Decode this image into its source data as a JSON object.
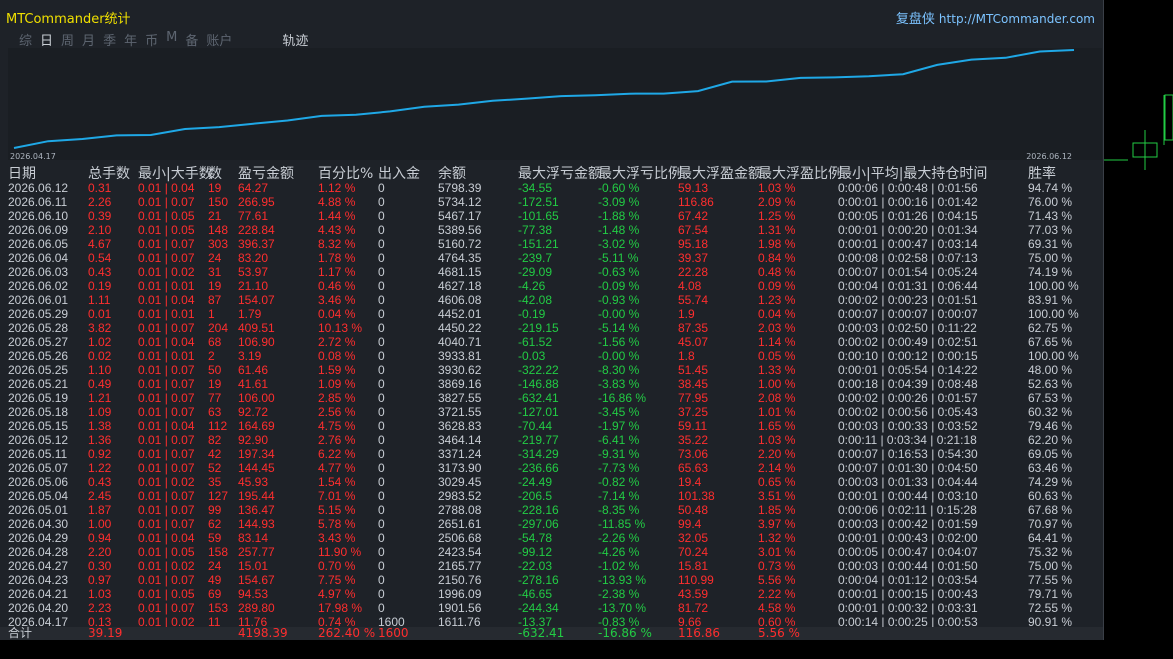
{
  "window": {
    "title": "MTCommander统计",
    "brand": "复盘侠",
    "url": "http://MTCommander.com"
  },
  "tabs": [
    {
      "label": "综",
      "active": false
    },
    {
      "label": "日",
      "active": true
    },
    {
      "label": "周",
      "active": false
    },
    {
      "label": "月",
      "active": false
    },
    {
      "label": "季",
      "active": false
    },
    {
      "label": "年",
      "active": false
    },
    {
      "label": "币",
      "active": false
    },
    {
      "label": "M",
      "active": false
    },
    {
      "label": "备",
      "active": false
    },
    {
      "label": "账户",
      "active": false
    },
    {
      "label": "轨迹",
      "active": false
    }
  ],
  "chart_data": {
    "type": "line",
    "x_start_label": "2026.04.17",
    "x_end_label": "2026.06.12",
    "x": [
      "2026.04.17",
      "2026.04.20",
      "2026.04.21",
      "2026.04.23",
      "2026.04.27",
      "2026.04.28",
      "2026.04.29",
      "2026.04.30",
      "2026.05.01",
      "2026.05.04",
      "2026.05.06",
      "2026.05.07",
      "2026.05.11",
      "2026.05.12",
      "2026.05.15",
      "2026.05.18",
      "2026.05.19",
      "2026.05.21",
      "2026.05.25",
      "2026.05.26",
      "2026.05.27",
      "2026.05.28",
      "2026.05.29",
      "2026.06.01",
      "2026.06.02",
      "2026.06.03",
      "2026.06.04",
      "2026.06.05",
      "2026.06.09",
      "2026.06.10",
      "2026.06.11",
      "2026.06.12"
    ],
    "values": [
      1611.76,
      1901.56,
      1996.09,
      2150.76,
      2165.77,
      2423.54,
      2506.68,
      2651.61,
      2788.08,
      2983.52,
      3029.45,
      3173.9,
      3371.24,
      3464.14,
      3628.83,
      3721.55,
      3827.55,
      3869.16,
      3930.62,
      3933.81,
      4040.71,
      4450.22,
      4452.01,
      4606.08,
      4627.18,
      4681.15,
      4764.35,
      5160.72,
      5389.56,
      5467.17,
      5734.12,
      5798.39
    ],
    "series_color": "#1fa8e6"
  },
  "table": {
    "headers": [
      "日期",
      "总手数",
      "最小|大手数",
      "数",
      "盈亏金额",
      "百分比%",
      "出入金",
      "余额",
      "最大浮亏金额",
      "最大浮亏比例",
      "最大浮盈金额",
      "最大浮盈比例",
      "最小|平均|最大持仓时间",
      "胜率"
    ],
    "rows": [
      [
        "2026.06.12",
        "0.31",
        "0.01 | 0.04",
        "19",
        "64.27",
        "1.12 %",
        "0",
        "5798.39",
        "-34.55",
        "-0.60 %",
        "59.13",
        "1.03 %",
        "0:00:06 | 0:00:48 | 0:01:56",
        "94.74 %"
      ],
      [
        "2026.06.11",
        "2.26",
        "0.01 | 0.07",
        "150",
        "266.95",
        "4.88 %",
        "0",
        "5734.12",
        "-172.51",
        "-3.09 %",
        "116.86",
        "2.09 %",
        "0:00:01 | 0:00:16 | 0:01:42",
        "76.00 %"
      ],
      [
        "2026.06.10",
        "0.39",
        "0.01 | 0.05",
        "21",
        "77.61",
        "1.44 %",
        "0",
        "5467.17",
        "-101.65",
        "-1.88 %",
        "67.42",
        "1.25 %",
        "0:00:05 | 0:01:26 | 0:04:15",
        "71.43 %"
      ],
      [
        "2026.06.09",
        "2.10",
        "0.01 | 0.05",
        "148",
        "228.84",
        "4.43 %",
        "0",
        "5389.56",
        "-77.38",
        "-1.48 %",
        "67.54",
        "1.31 %",
        "0:00:01 | 0:00:20 | 0:01:34",
        "77.03 %"
      ],
      [
        "2026.06.05",
        "4.67",
        "0.01 | 0.07",
        "303",
        "396.37",
        "8.32 %",
        "0",
        "5160.72",
        "-151.21",
        "-3.02 %",
        "95.18",
        "1.98 %",
        "0:00:01 | 0:00:47 | 0:03:14",
        "69.31 %"
      ],
      [
        "2026.06.04",
        "0.54",
        "0.01 | 0.07",
        "24",
        "83.20",
        "1.78 %",
        "0",
        "4764.35",
        "-239.7",
        "-5.11 %",
        "39.37",
        "0.84 %",
        "0:00:08 | 0:02:58 | 0:07:13",
        "75.00 %"
      ],
      [
        "2026.06.03",
        "0.43",
        "0.01 | 0.02",
        "31",
        "53.97",
        "1.17 %",
        "0",
        "4681.15",
        "-29.09",
        "-0.63 %",
        "22.28",
        "0.48 %",
        "0:00:07 | 0:01:54 | 0:05:24",
        "74.19 %"
      ],
      [
        "2026.06.02",
        "0.19",
        "0.01 | 0.01",
        "19",
        "21.10",
        "0.46 %",
        "0",
        "4627.18",
        "-4.26",
        "-0.09 %",
        "4.08",
        "0.09 %",
        "0:00:04 | 0:01:31 | 0:06:44",
        "100.00 %"
      ],
      [
        "2026.06.01",
        "1.11",
        "0.01 | 0.04",
        "87",
        "154.07",
        "3.46 %",
        "0",
        "4606.08",
        "-42.08",
        "-0.93 %",
        "55.74",
        "1.23 %",
        "0:00:02 | 0:00:23 | 0:01:51",
        "83.91 %"
      ],
      [
        "2026.05.29",
        "0.01",
        "0.01 | 0.01",
        "1",
        "1.79",
        "0.04 %",
        "0",
        "4452.01",
        "-0.19",
        "-0.00 %",
        "1.9",
        "0.04 %",
        "0:00:07 | 0:00:07 | 0:00:07",
        "100.00 %"
      ],
      [
        "2026.05.28",
        "3.82",
        "0.01 | 0.07",
        "204",
        "409.51",
        "10.13 %",
        "0",
        "4450.22",
        "-219.15",
        "-5.14 %",
        "87.35",
        "2.03 %",
        "0:00:03 | 0:02:50 | 0:11:22",
        "62.75 %"
      ],
      [
        "2026.05.27",
        "1.02",
        "0.01 | 0.04",
        "68",
        "106.90",
        "2.72 %",
        "0",
        "4040.71",
        "-61.52",
        "-1.56 %",
        "45.07",
        "1.14 %",
        "0:00:02 | 0:00:49 | 0:02:51",
        "67.65 %"
      ],
      [
        "2026.05.26",
        "0.02",
        "0.01 | 0.01",
        "2",
        "3.19",
        "0.08 %",
        "0",
        "3933.81",
        "-0.03",
        "-0.00 %",
        "1.8",
        "0.05 %",
        "0:00:10 | 0:00:12 | 0:00:15",
        "100.00 %"
      ],
      [
        "2026.05.25",
        "1.10",
        "0.01 | 0.07",
        "50",
        "61.46",
        "1.59 %",
        "0",
        "3930.62",
        "-322.22",
        "-8.30 %",
        "51.45",
        "1.33 %",
        "0:00:01 | 0:05:54 | 0:14:22",
        "48.00 %"
      ],
      [
        "2026.05.21",
        "0.49",
        "0.01 | 0.07",
        "19",
        "41.61",
        "1.09 %",
        "0",
        "3869.16",
        "-146.88",
        "-3.83 %",
        "38.45",
        "1.00 %",
        "0:00:18 | 0:04:39 | 0:08:48",
        "52.63 %"
      ],
      [
        "2026.05.19",
        "1.21",
        "0.01 | 0.07",
        "77",
        "106.00",
        "2.85 %",
        "0",
        "3827.55",
        "-632.41",
        "-16.86 %",
        "77.95",
        "2.08 %",
        "0:00:02 | 0:00:26 | 0:01:57",
        "67.53 %"
      ],
      [
        "2026.05.18",
        "1.09",
        "0.01 | 0.07",
        "63",
        "92.72",
        "2.56 %",
        "0",
        "3721.55",
        "-127.01",
        "-3.45 %",
        "37.25",
        "1.01 %",
        "0:00:02 | 0:00:56 | 0:05:43",
        "60.32 %"
      ],
      [
        "2026.05.15",
        "1.38",
        "0.01 | 0.04",
        "112",
        "164.69",
        "4.75 %",
        "0",
        "3628.83",
        "-70.44",
        "-1.97 %",
        "59.11",
        "1.65 %",
        "0:00:03 | 0:00:33 | 0:03:52",
        "79.46 %"
      ],
      [
        "2026.05.12",
        "1.36",
        "0.01 | 0.07",
        "82",
        "92.90",
        "2.76 %",
        "0",
        "3464.14",
        "-219.77",
        "-6.41 %",
        "35.22",
        "1.03 %",
        "0:00:11 | 0:03:34 | 0:21:18",
        "62.20 %"
      ],
      [
        "2026.05.11",
        "0.92",
        "0.01 | 0.07",
        "42",
        "197.34",
        "6.22 %",
        "0",
        "3371.24",
        "-314.29",
        "-9.31 %",
        "73.06",
        "2.20 %",
        "0:00:07 | 0:16:53 | 0:54:30",
        "69.05 %"
      ],
      [
        "2026.05.07",
        "1.22",
        "0.01 | 0.07",
        "52",
        "144.45",
        "4.77 %",
        "0",
        "3173.90",
        "-236.66",
        "-7.73 %",
        "65.63",
        "2.14 %",
        "0:00:07 | 0:01:30 | 0:04:50",
        "63.46 %"
      ],
      [
        "2026.05.06",
        "0.43",
        "0.01 | 0.02",
        "35",
        "45.93",
        "1.54 %",
        "0",
        "3029.45",
        "-24.49",
        "-0.82 %",
        "19.4",
        "0.65 %",
        "0:00:03 | 0:01:33 | 0:04:44",
        "74.29 %"
      ],
      [
        "2026.05.04",
        "2.45",
        "0.01 | 0.07",
        "127",
        "195.44",
        "7.01 %",
        "0",
        "2983.52",
        "-206.5",
        "-7.14 %",
        "101.38",
        "3.51 %",
        "0:00:01 | 0:00:44 | 0:03:10",
        "60.63 %"
      ],
      [
        "2026.05.01",
        "1.87",
        "0.01 | 0.07",
        "99",
        "136.47",
        "5.15 %",
        "0",
        "2788.08",
        "-228.16",
        "-8.35 %",
        "50.48",
        "1.85 %",
        "0:00:06 | 0:02:11 | 0:15:28",
        "67.68 %"
      ],
      [
        "2026.04.30",
        "1.00",
        "0.01 | 0.07",
        "62",
        "144.93",
        "5.78 %",
        "0",
        "2651.61",
        "-297.06",
        "-11.85 %",
        "99.4",
        "3.97 %",
        "0:00:03 | 0:00:42 | 0:01:59",
        "70.97 %"
      ],
      [
        "2026.04.29",
        "0.94",
        "0.01 | 0.04",
        "59",
        "83.14",
        "3.43 %",
        "0",
        "2506.68",
        "-54.78",
        "-2.26 %",
        "32.05",
        "1.32 %",
        "0:00:01 | 0:00:43 | 0:02:00",
        "64.41 %"
      ],
      [
        "2026.04.28",
        "2.20",
        "0.01 | 0.05",
        "158",
        "257.77",
        "11.90 %",
        "0",
        "2423.54",
        "-99.12",
        "-4.26 %",
        "70.24",
        "3.01 %",
        "0:00:05 | 0:00:47 | 0:04:07",
        "75.32 %"
      ],
      [
        "2026.04.27",
        "0.30",
        "0.01 | 0.02",
        "24",
        "15.01",
        "0.70 %",
        "0",
        "2165.77",
        "-22.03",
        "-1.02 %",
        "15.81",
        "0.73 %",
        "0:00:03 | 0:00:44 | 0:01:50",
        "75.00 %"
      ],
      [
        "2026.04.23",
        "0.97",
        "0.01 | 0.07",
        "49",
        "154.67",
        "7.75 %",
        "0",
        "2150.76",
        "-278.16",
        "-13.93 %",
        "110.99",
        "5.56 %",
        "0:00:04 | 0:01:12 | 0:03:54",
        "77.55 %"
      ],
      [
        "2026.04.21",
        "1.03",
        "0.01 | 0.05",
        "69",
        "94.53",
        "4.97 %",
        "0",
        "1996.09",
        "-46.65",
        "-2.38 %",
        "43.59",
        "2.22 %",
        "0:00:01 | 0:00:15 | 0:00:43",
        "79.71 %"
      ],
      [
        "2026.04.20",
        "2.23",
        "0.01 | 0.07",
        "153",
        "289.80",
        "17.98 %",
        "0",
        "1901.56",
        "-244.34",
        "-13.70 %",
        "81.72",
        "4.58 %",
        "0:00:01 | 0:00:32 | 0:03:31",
        "72.55 %"
      ],
      [
        "2026.04.17",
        "0.13",
        "0.01 | 0.02",
        "11",
        "11.76",
        "0.74 %",
        "1600",
        "1611.76",
        "-13.37",
        "-0.83 %",
        "9.66",
        "0.60 %",
        "0:00:14 | 0:00:25 | 0:00:53",
        "90.91 %"
      ]
    ],
    "totals": {
      "label": "合计",
      "lots": "39.19",
      "profit": "4198.39",
      "pct": "262.40 %",
      "deposit": "1600",
      "max_loss": "-632.41",
      "max_loss_pct": "-16.86 %",
      "max_gain": "116.86",
      "max_gain_pct": "5.56 %"
    }
  }
}
